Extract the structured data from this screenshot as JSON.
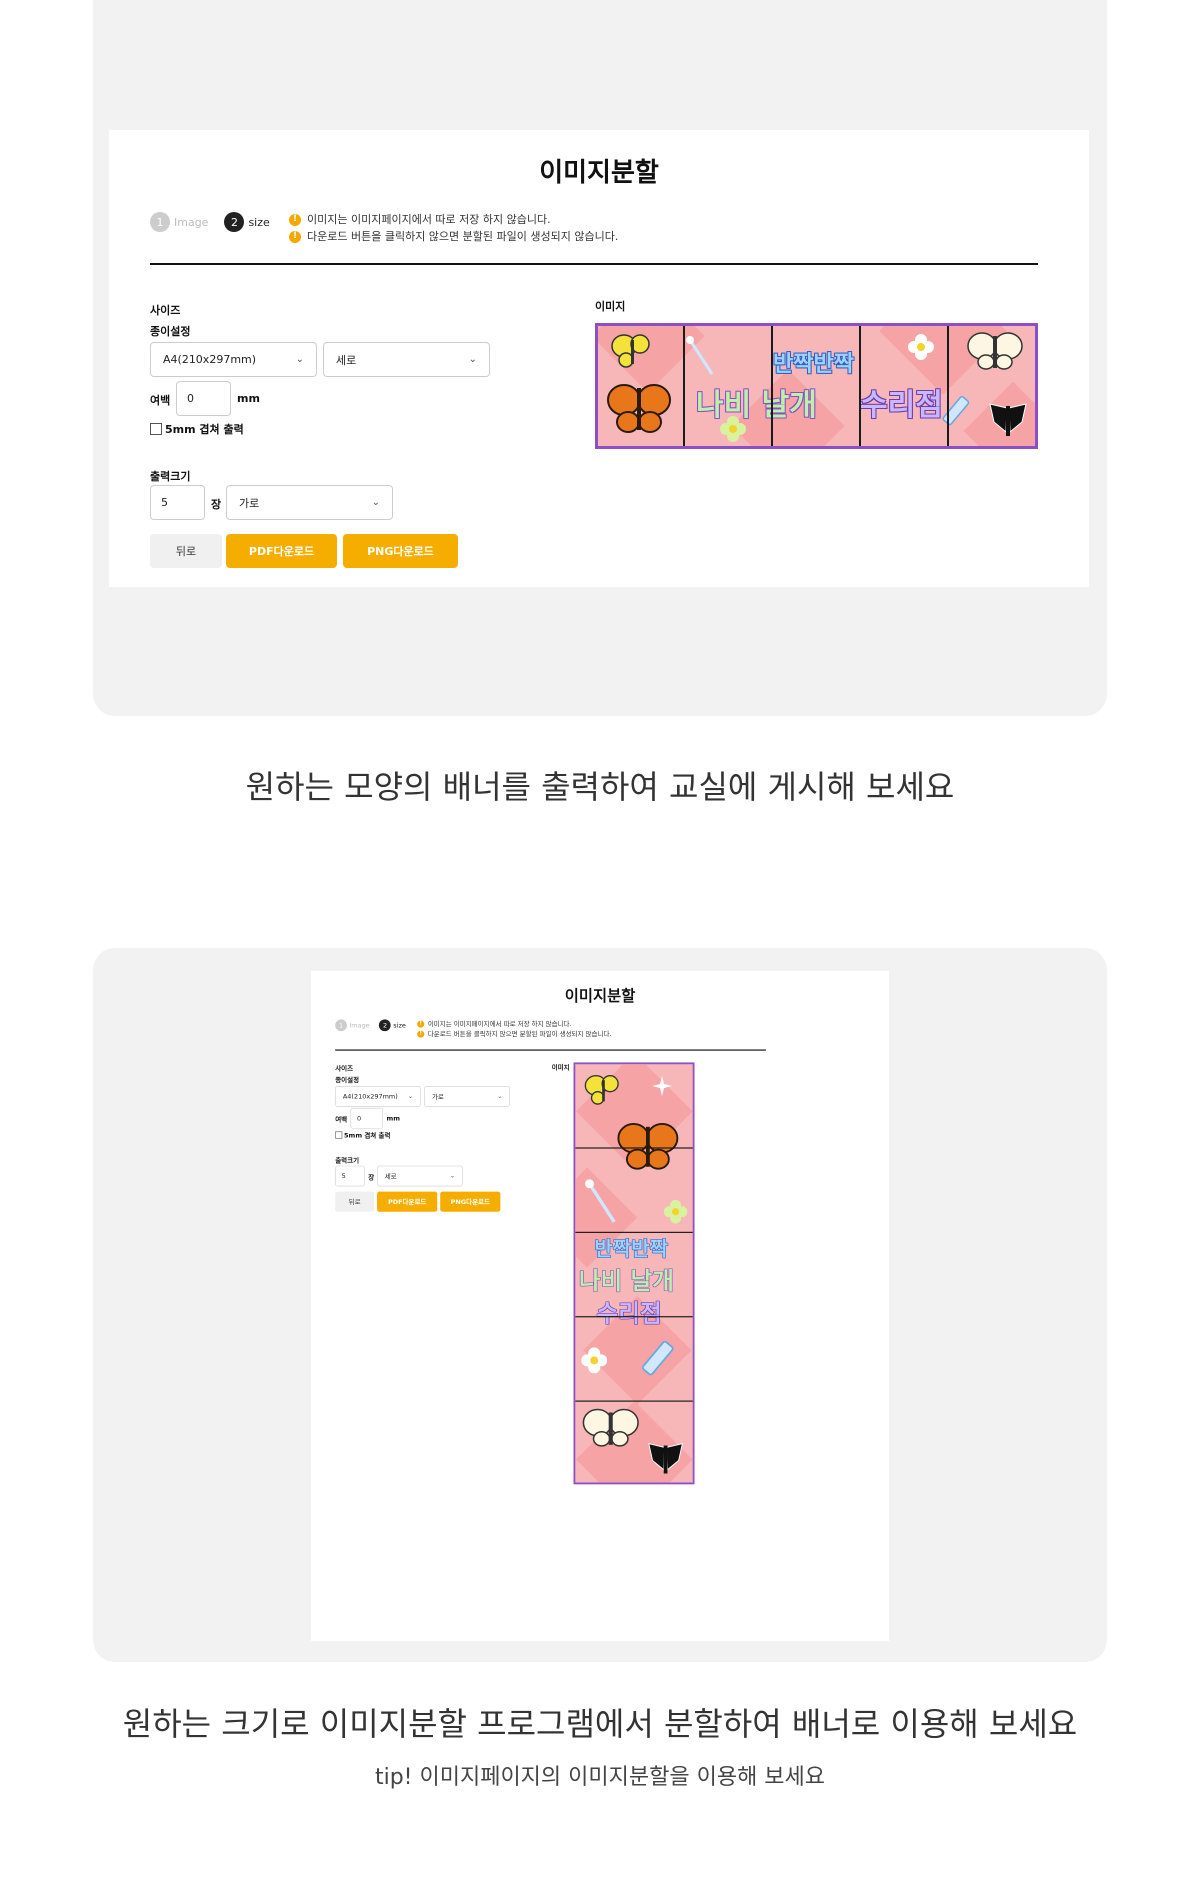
{
  "app": {
    "title": "이미지분할",
    "steps": [
      {
        "num": "1",
        "label": "Image"
      },
      {
        "num": "2",
        "label": "size"
      }
    ],
    "notices": [
      "이미지는 이미지페이지에서 따로 저장 하지 않습니다.",
      "다운로드 버튼을 클릭하지 않으면 분할된 파일이 생성되지 않습니다."
    ],
    "size_label": "사이즈",
    "paper_label": "종이설정",
    "paper_value": "A4(210x297mm)",
    "margin_label": "여백",
    "margin_value": "0",
    "margin_unit": "mm",
    "overlap_label": "5mm 겹쳐 출력",
    "output_label": "출력크기",
    "count_value": "5",
    "count_unit": "장",
    "back_label": "뒤로",
    "pdf_label": "PDF다운로드",
    "png_label": "PNG다운로드",
    "image_label": "이미지",
    "banner_line1": "반짝반짝",
    "banner_line2": "나비 날개",
    "banner_line3": "수리점"
  },
  "screens": [
    {
      "orientation": "세로",
      "direction": "가로"
    },
    {
      "orientation": "가로",
      "direction": "세로"
    }
  ],
  "captions": {
    "first": "원하는 모양의 배너를 출력하여 교실에 게시해 보세요",
    "second": "원하는 크기로 이미지분할 프로그램에서 분할하여 배너로 이용해 보세요",
    "tip": "tip! 이미지페이지의 이미지분할을 이용해 보세요"
  },
  "colors": {
    "accent": "#f5ae00",
    "banner_border": "#8a4fc9",
    "banner_bg": "#f7b7b8"
  }
}
